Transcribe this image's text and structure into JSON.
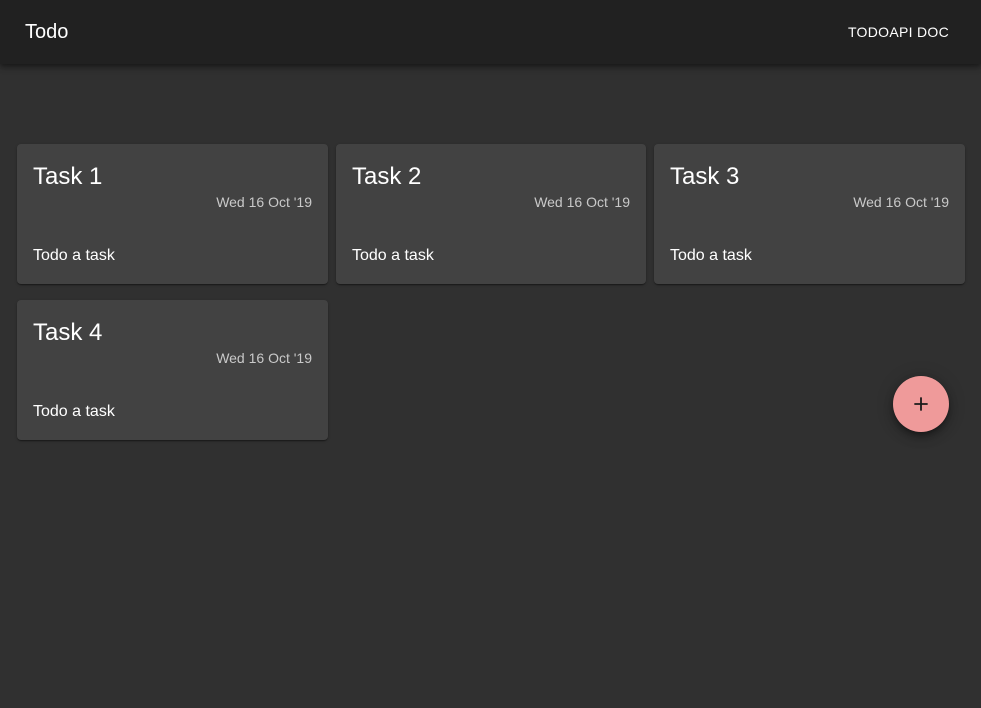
{
  "appbar": {
    "title": "Todo",
    "doc_link": "TODOAPI DOC"
  },
  "tasks": [
    {
      "title": "Task 1",
      "date": "Wed 16 Oct '19",
      "text": "Todo a task"
    },
    {
      "title": "Task 2",
      "date": "Wed 16 Oct '19",
      "text": "Todo a task"
    },
    {
      "title": "Task 3",
      "date": "Wed 16 Oct '19",
      "text": "Todo a task"
    },
    {
      "title": "Task 4",
      "date": "Wed 16 Oct '19",
      "text": "Todo a task"
    }
  ],
  "fab": {
    "icon": "plus-icon",
    "color": "#ef9a9a"
  },
  "colors": {
    "background": "#303030",
    "appbar": "#212121",
    "card": "#424242",
    "accent": "#ef9a9a"
  }
}
